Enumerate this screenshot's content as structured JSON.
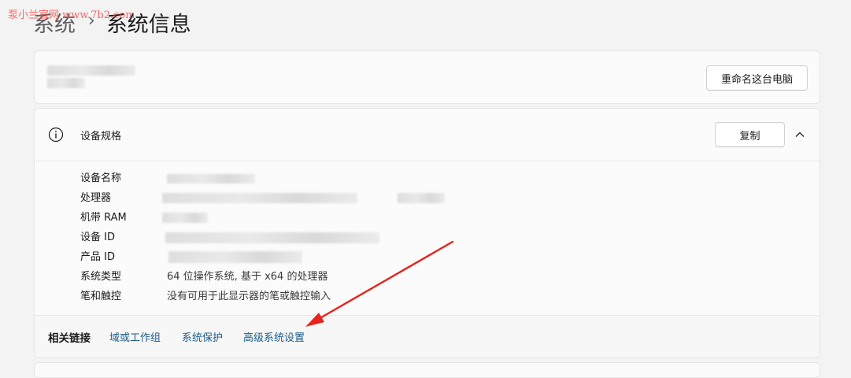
{
  "watermark": "泵小兰官网 www.7b2.com",
  "breadcrumb": {
    "parent": "系统",
    "separator": "›",
    "current": "系统信息"
  },
  "device_card": {
    "rename_button": "重命名这台电脑"
  },
  "spec_card": {
    "title": "设备规格",
    "copy_button": "复制",
    "rows": [
      {
        "label": "设备名称",
        "value": ""
      },
      {
        "label": "处理器",
        "value": ""
      },
      {
        "label": "机带 RAM",
        "value": ""
      },
      {
        "label": "设备 ID",
        "value": ""
      },
      {
        "label": "产品 ID",
        "value": ""
      },
      {
        "label": "系统类型",
        "value": "64 位操作系统, 基于 x64 的处理器"
      },
      {
        "label": "笔和触控",
        "value": "没有可用于此显示器的笔或触控输入"
      }
    ]
  },
  "related_links": {
    "title": "相关链接",
    "links": [
      "域或工作组",
      "系统保护",
      "高级系统设置"
    ]
  },
  "colors": {
    "background": "#f3f3f3",
    "card": "#fbfbfb",
    "link": "#1a5b8c",
    "annotation_arrow": "#e8221c",
    "watermark": "#ff4d4d"
  },
  "icons": [
    "info-icon",
    "chevron-up-icon",
    "annotation-arrow"
  ]
}
